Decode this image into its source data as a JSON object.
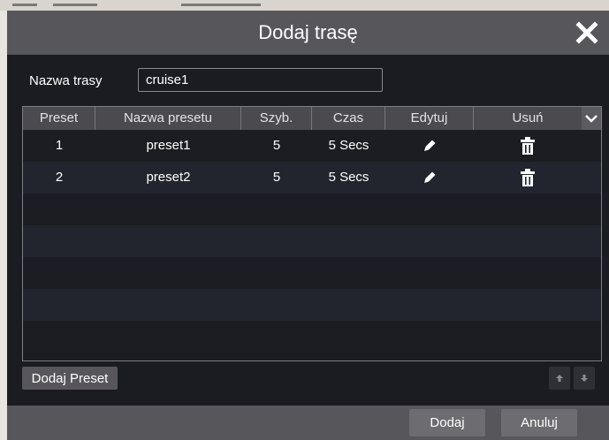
{
  "dialog": {
    "title": "Dodaj trasę",
    "close_icon": "close-icon"
  },
  "form": {
    "name_label": "Nazwa trasy",
    "name_value": "cruise1"
  },
  "table": {
    "columns": [
      "Preset",
      "Nazwa presetu",
      "Szyb.",
      "Czas",
      "Edytuj",
      "Usuń"
    ],
    "rows": [
      {
        "preset": "1",
        "name": "preset1",
        "speed": "5",
        "time": "5 Secs",
        "edit_icon": "pencil-icon",
        "delete_icon": "trash-icon"
      },
      {
        "preset": "2",
        "name": "preset2",
        "speed": "5",
        "time": "5 Secs",
        "edit_icon": "pencil-icon",
        "delete_icon": "trash-icon"
      }
    ],
    "empty_rows": 5
  },
  "toolbar": {
    "add_preset_label": "Dodaj Preset",
    "move_up_icon": "arrow-up-icon",
    "move_down_icon": "arrow-down-icon"
  },
  "footer": {
    "add_label": "Dodaj",
    "cancel_label": "Anuluj"
  },
  "colors": {
    "dialog_bg": "#1b1c21",
    "titlebar": "#57575b",
    "header_bg": "#4b4b4f",
    "row_alt": "#23252e",
    "text": "#ffffff"
  }
}
